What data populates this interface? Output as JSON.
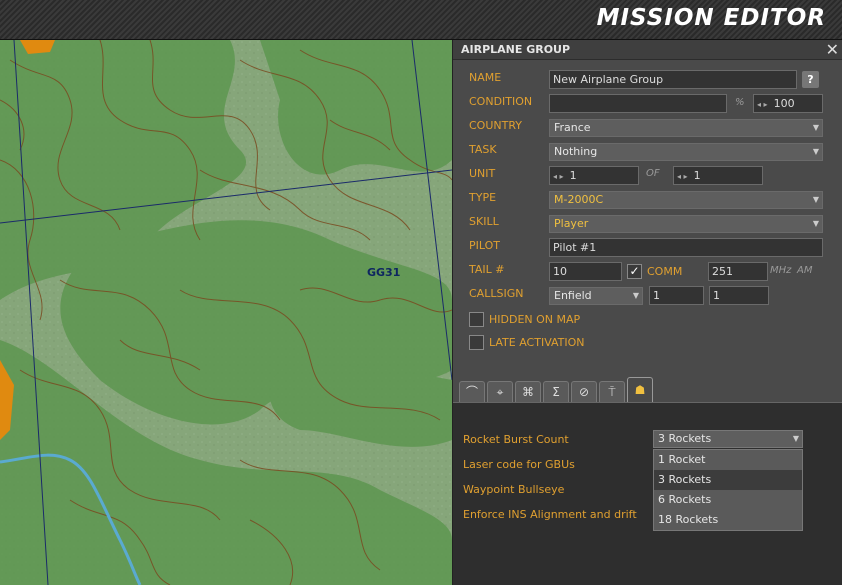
{
  "app": {
    "title": "MISSION EDITOR"
  },
  "map": {
    "grid_label": "GG31"
  },
  "panel": {
    "title": "AIRPLANE GROUP",
    "close_glyph": "✕",
    "help_glyph": "?",
    "labels": {
      "name": "NAME",
      "condition": "CONDITION",
      "country": "COUNTRY",
      "task": "TASK",
      "unit": "UNIT",
      "type": "TYPE",
      "skill": "SKILL",
      "pilot": "PILOT",
      "tail": "TAIL #",
      "callsign": "CALLSIGN",
      "comm": "COMM",
      "of": "OF",
      "percent": "%",
      "freq_unit": "MHz",
      "mod": "AM"
    },
    "values": {
      "name": "New Airplane Group",
      "condition": "",
      "condition_pct": "100",
      "country": "France",
      "task": "Nothing",
      "unit_index": "1",
      "unit_total": "1",
      "type": "M-2000C",
      "skill": "Player",
      "pilot": "Pilot #1",
      "tail": "10",
      "comm_checked": true,
      "comm_freq": "251",
      "callsign_name": "Enfield",
      "callsign_num1": "1",
      "callsign_num2": "1"
    },
    "checkboxes": {
      "hidden_on_map": "HIDDEN ON MAP",
      "late_activation": "LATE ACTIVATION"
    },
    "tabs": [
      {
        "icon": "route-icon",
        "glyph": "⌒"
      },
      {
        "icon": "target-icon",
        "glyph": "⌖"
      },
      {
        "icon": "command-icon",
        "glyph": "⌘"
      },
      {
        "icon": "summary-icon",
        "glyph": "Σ"
      },
      {
        "icon": "failures-icon",
        "glyph": "⊘"
      },
      {
        "icon": "radio-icon",
        "glyph": "⍑"
      },
      {
        "icon": "aircraft-options-icon",
        "glyph": "☗"
      }
    ],
    "options": {
      "rocket_burst_label": "Rocket Burst Count",
      "laser_code_label": "Laser code for GBUs",
      "waypoint_bullseye_label": "Waypoint Bullseye",
      "ins_label": "Enforce INS Alignment and drift",
      "rocket_burst_value": "3 Rockets",
      "rocket_burst_options": [
        "1 Rocket",
        "3 Rockets",
        "6 Rockets",
        "18 Rockets"
      ]
    }
  },
  "colors": {
    "label_orange": "#e0a030",
    "panel_bg": "#4a4a4a",
    "map_green": "#6c9a5c",
    "contour_brown": "#7a4a20",
    "grid_line": "#1a2a6a"
  }
}
